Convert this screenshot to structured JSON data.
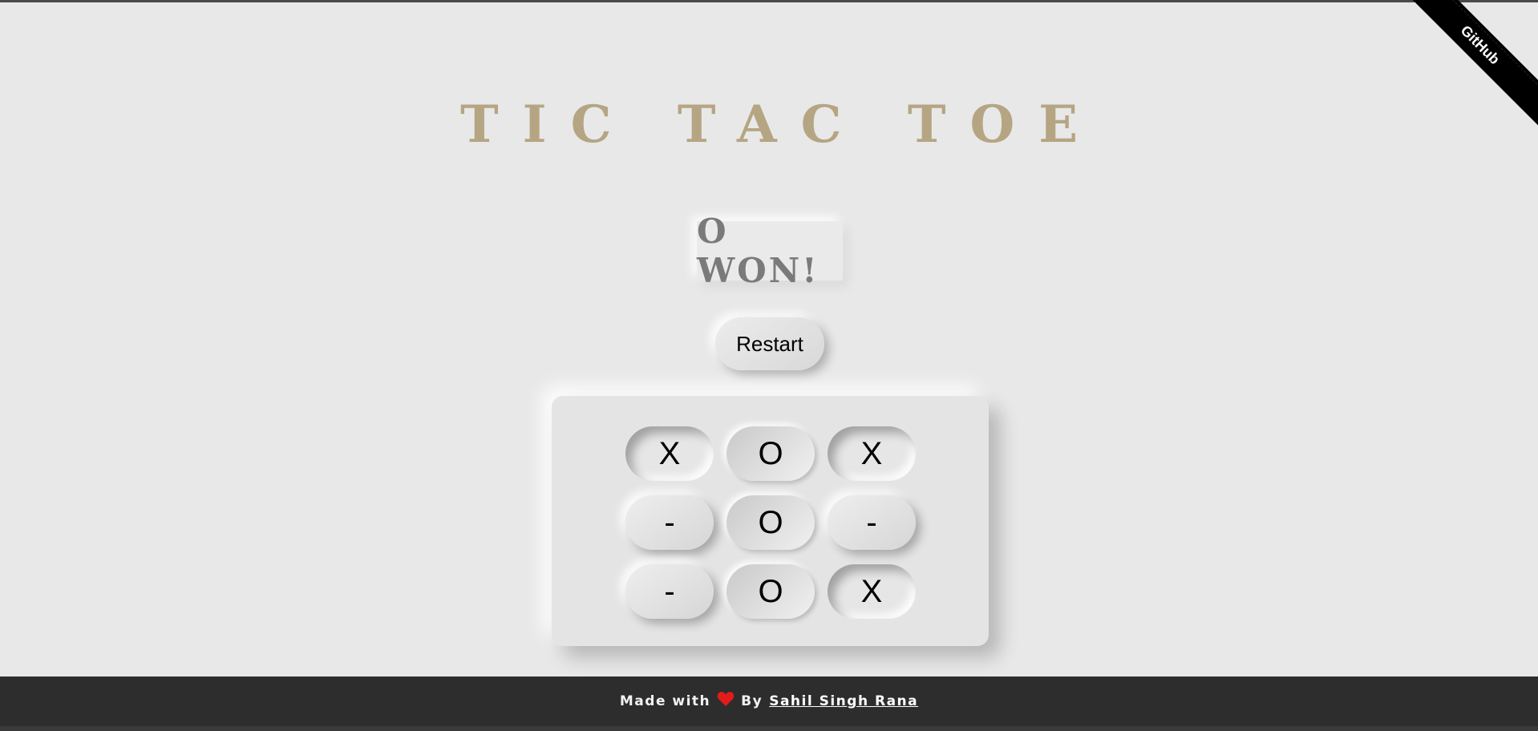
{
  "header": {
    "title": "TIC TAC TOE"
  },
  "ribbon": {
    "label": "GitHub"
  },
  "game": {
    "status": "O WON!",
    "restart_label": "Restart",
    "board": [
      [
        "X",
        "O",
        "X"
      ],
      [
        "-",
        "O",
        "-"
      ],
      [
        "-",
        "O",
        "X"
      ]
    ]
  },
  "footer": {
    "made_with": "Made with",
    "by": "By",
    "author": "Sahil Singh Rana",
    "heart_icon": "heart-icon",
    "heart_color": "#e31b1b"
  },
  "colors": {
    "title": "#b5a582",
    "status": "#7a7a7a",
    "background": "#e8e8e8",
    "footer_bg": "#2d2d2d"
  }
}
